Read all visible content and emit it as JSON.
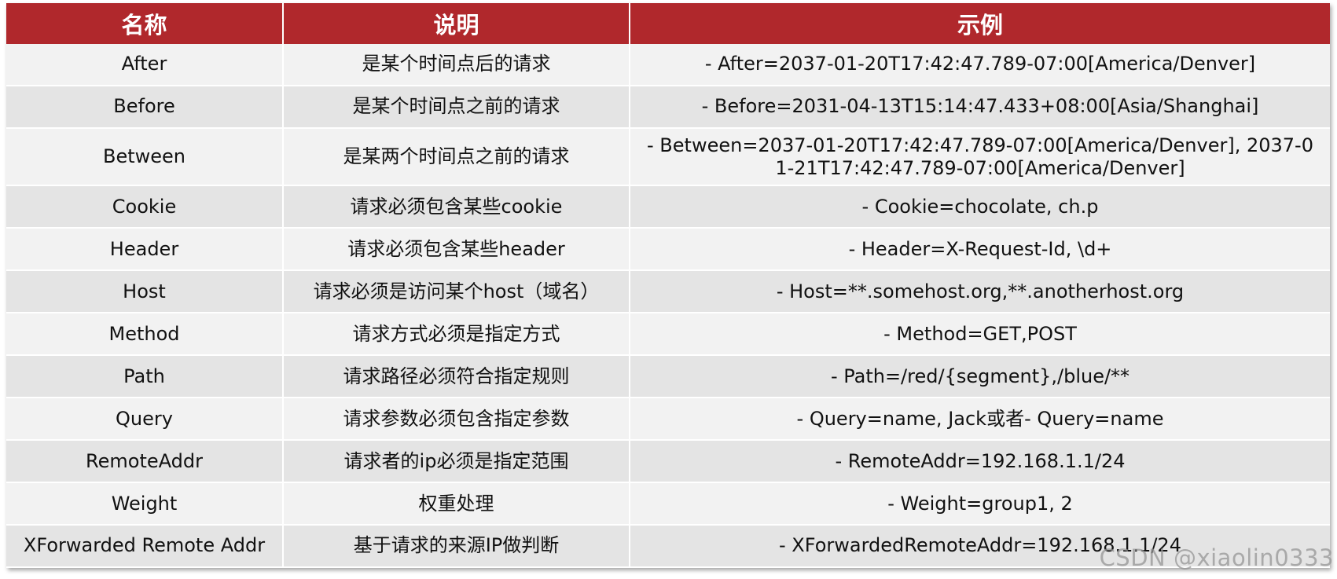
{
  "table": {
    "headers": [
      "名称",
      "说明",
      "示例"
    ],
    "rows": [
      {
        "name": "After",
        "desc": "是某个时间点后的请求",
        "example": "- After=2037-01-20T17:42:47.789-07:00[America/Denver]"
      },
      {
        "name": "Before",
        "desc": "是某个时间点之前的请求",
        "example": "- Before=2031-04-13T15:14:47.433+08:00[Asia/Shanghai]"
      },
      {
        "name": "Between",
        "desc": "是某两个时间点之前的请求",
        "example": "- Between=2037-01-20T17:42:47.789-07:00[America/Denver], 2037-01-21T17:42:47.789-07:00[America/Denver]"
      },
      {
        "name": "Cookie",
        "desc": "请求必须包含某些cookie",
        "example": "- Cookie=chocolate, ch.p"
      },
      {
        "name": "Header",
        "desc": "请求必须包含某些header",
        "example": "- Header=X-Request-Id, \\d+"
      },
      {
        "name": "Host",
        "desc": "请求必须是访问某个host（域名）",
        "example": "- Host=**.somehost.org,**.anotherhost.org"
      },
      {
        "name": "Method",
        "desc": "请求方式必须是指定方式",
        "example": "- Method=GET,POST"
      },
      {
        "name": "Path",
        "desc": "请求路径必须符合指定规则",
        "example": "- Path=/red/{segment},/blue/**"
      },
      {
        "name": "Query",
        "desc": "请求参数必须包含指定参数",
        "example": "- Query=name, Jack或者- Query=name"
      },
      {
        "name": "RemoteAddr",
        "desc": "请求者的ip必须是指定范围",
        "example": "- RemoteAddr=192.168.1.1/24"
      },
      {
        "name": "Weight",
        "desc": "权重处理",
        "example": "- Weight=group1, 2"
      },
      {
        "name": "XForwarded Remote Addr",
        "desc": "基于请求的来源IP做判断",
        "example": "- XForwardedRemoteAddr=192.168.1.1/24"
      }
    ]
  },
  "watermark": "CSDN @xiaolin0333",
  "colors": {
    "header_bg": "#b0282c",
    "header_text": "#ffffff",
    "row_light": "#f2f2f2",
    "row_dark": "#e4e4e4"
  }
}
